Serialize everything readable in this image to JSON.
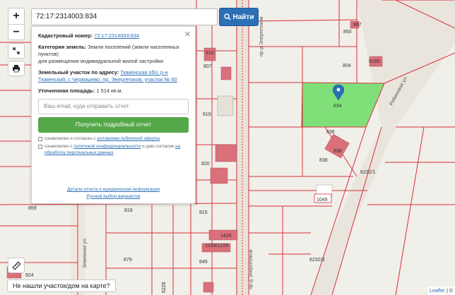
{
  "search": {
    "value": "72:17:2314003:834",
    "button_label": "Найти"
  },
  "zoom": {
    "in_label": "+",
    "out_label": "−"
  },
  "panel": {
    "cadastral_label": "Кадастровый номер:",
    "cadastral_value": "72:17:2314003:834",
    "category_label": "Категория земель:",
    "category_value": "Земли поселений (земли населенных пунктов)",
    "category_note": "для размещения индивидуальной жилой застройки",
    "address_label": "Земельный участок по адресу:",
    "address_value": "Тюменская обл, р-н Тюменский, с Червишево, пр. Энергетиков, участок № 60",
    "area_label": "Уточненная площадь:",
    "area_value": "1 514 кв.м.",
    "email_placeholder": "Ваш email, куда отправить отчет",
    "report_button": "Получить подробный отчет",
    "consent1_pre": "ознакомлен и согласен с ",
    "consent1_link": "условиями публичной оферты",
    "consent2_pre": "ознакомлен с ",
    "consent2_link1": "политикой конфиденциальности",
    "consent2_mid": " и даю согласие ",
    "consent2_link2": "на обработку персональных данных",
    "details_link": "Детали отчета и юридическая информация",
    "manual_link": "Ручной выбор вариантов"
  },
  "map": {
    "labels": [
      {
        "text": "967"
      },
      {
        "text": "850"
      },
      {
        "text": "916"
      },
      {
        "text": "807"
      },
      {
        "text": "804"
      },
      {
        "text": "6189"
      },
      {
        "text": "834"
      },
      {
        "text": "819"
      },
      {
        "text": "838"
      },
      {
        "text": "838"
      },
      {
        "text": "838"
      },
      {
        "text": "6232/1"
      },
      {
        "text": "820"
      },
      {
        "text": "1049"
      },
      {
        "text": "859"
      },
      {
        "text": "818"
      },
      {
        "text": "815"
      },
      {
        "text": "1420"
      },
      {
        "text": "1228/1228"
      },
      {
        "text": "879"
      },
      {
        "text": "849"
      },
      {
        "text": "6232/3"
      },
      {
        "text": "924"
      },
      {
        "text": "6228"
      }
    ],
    "road_labels": [
      "пр-д Энергетиков",
      "пр-д Энергетиков",
      "Земляная ул.",
      "Рябиновая ул."
    ],
    "parcel_color": "#7fe07a",
    "boundary_color": "#d8303a",
    "building_color": "#d9707a"
  },
  "bottom": {
    "not_found_button": "Не нашли участок/дом на карте?",
    "attribution_link": "Leaflet",
    "attribution_rest": "| ©"
  }
}
